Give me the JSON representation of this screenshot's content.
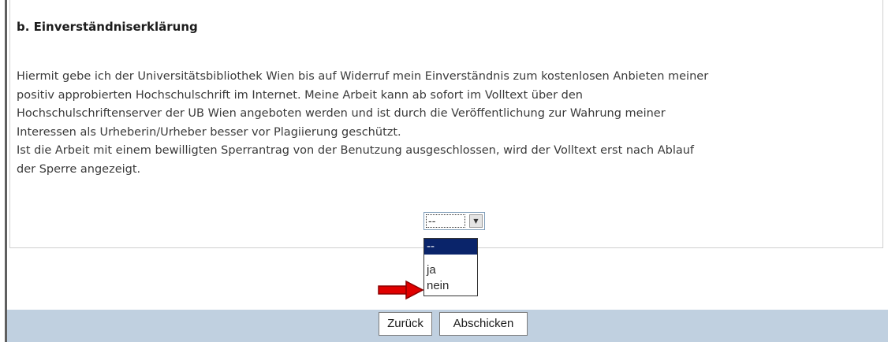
{
  "section": {
    "heading": "b. Einverständniserklärung",
    "paragraph_lines": [
      "Hiermit gebe ich der Universitätsbibliothek Wien bis auf Widerruf mein Einverständnis zum kostenlosen Anbieten meiner",
      "positiv approbierten Hochschulschrift im Internet. Meine Arbeit kann ab sofort im Volltext über den",
      "Hochschulschriftenserver der UB Wien angeboten werden und ist durch die Veröffentlichung zur Wahrung meiner",
      "Interessen als Urheberin/Urheber besser vor Plagiierung geschützt.",
      "Ist die Arbeit mit einem bewilligten Sperrantrag von der Benutzung ausgeschlossen, wird der Volltext erst nach Ablauf",
      "der Sperre angezeigt."
    ]
  },
  "consent_select": {
    "selected_value": "--",
    "options": [
      "--",
      "ja",
      "nein"
    ],
    "highlighted_option": "--"
  },
  "annotation": {
    "arrow_color": "#e00000",
    "points_to": "nein"
  },
  "footer": {
    "back_label": "Zurück",
    "submit_label": "Abschicken",
    "bar_color": "#c0d0e0"
  }
}
